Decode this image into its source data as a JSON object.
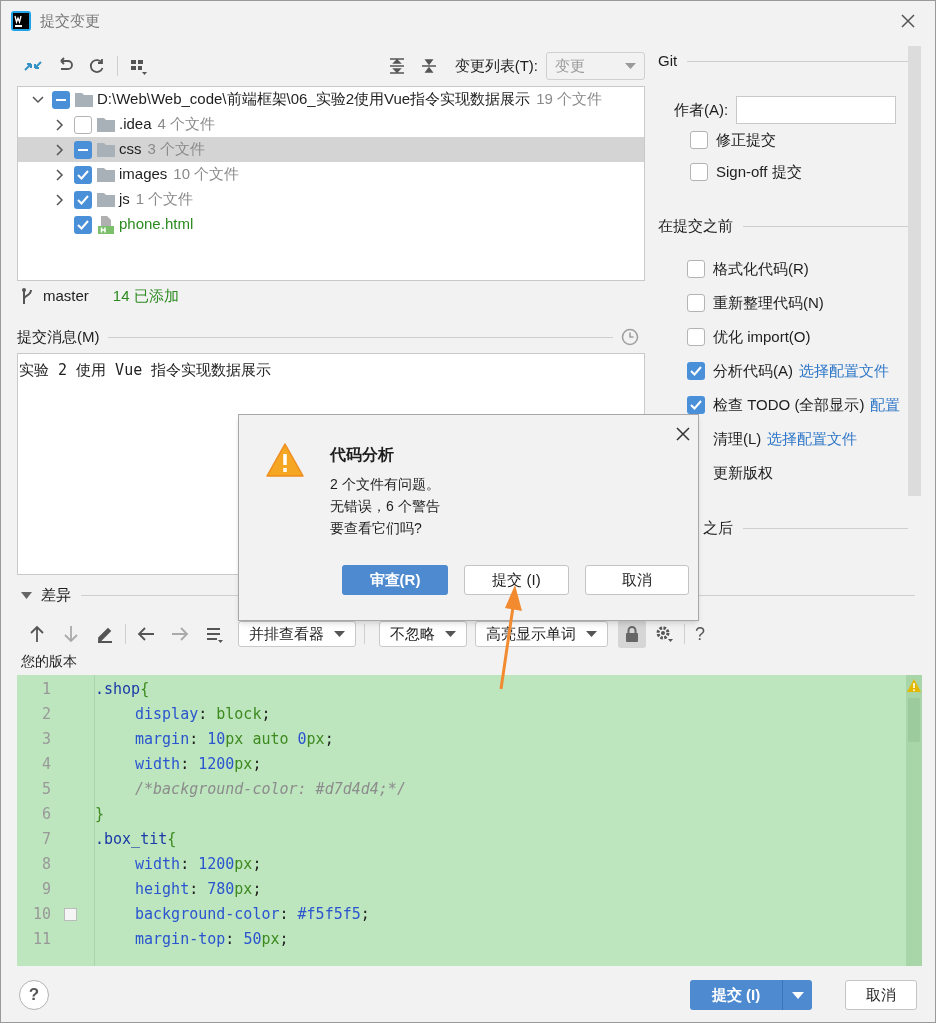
{
  "window": {
    "title": "提交变更"
  },
  "changes_toolbar": {
    "changelist_label": "变更列表(T):",
    "changelist_value": "变更"
  },
  "tree": [
    {
      "label": "D:\\Web\\Web_code\\前端框架\\06_实验2使用Vue指令实现数据展示",
      "count": "19 个文件",
      "kind": "folder",
      "partial": true,
      "expanded": true,
      "selected": false,
      "children": [
        {
          "label": ".idea",
          "count": "4 个文件",
          "kind": "folder",
          "checked": false,
          "expanded": false,
          "selected": false
        },
        {
          "label": "css",
          "count": "3 个文件",
          "kind": "folder",
          "partial": true,
          "expanded": false,
          "selected": true
        },
        {
          "label": "images",
          "count": "10 个文件",
          "kind": "folder",
          "checked": true,
          "expanded": false,
          "selected": false
        },
        {
          "label": "js",
          "count": "1 个文件",
          "kind": "folder",
          "checked": true,
          "expanded": false,
          "selected": false
        },
        {
          "label": "phone.html",
          "kind": "html",
          "checked": true,
          "added": true,
          "selected": false
        }
      ]
    }
  ],
  "branch": {
    "name": "master",
    "status": "14 已添加"
  },
  "commit_message": {
    "label": "提交消息(M)",
    "value": "实验 2 使用 Vue 指令实现数据展示"
  },
  "git": {
    "title": "Git",
    "author_label": "作者(A):",
    "options": [
      {
        "label": "修正提交",
        "checked": false
      },
      {
        "label": "Sign-off 提交",
        "checked": false
      }
    ]
  },
  "before_commit": {
    "title": "在提交之前",
    "options": [
      {
        "label": "格式化代码(R)",
        "checked": false
      },
      {
        "label": "重新整理代码(N)",
        "checked": false
      },
      {
        "label": "优化 import(O)",
        "checked": false
      },
      {
        "label": "分析代码(A)",
        "checked": true,
        "link": "选择配置文件"
      },
      {
        "label": "检查 TODO (全部显示)",
        "checked": true,
        "link": "配置"
      },
      {
        "label": "清理(L)",
        "link": "选择配置文件"
      },
      {
        "label": "更新版权"
      }
    ]
  },
  "after_commit": {
    "title": "之后"
  },
  "diff": {
    "label": "差异",
    "expanded": true,
    "dropdowns": [
      "并排查看器",
      "不忽略",
      "高亮显示单词"
    ],
    "lock_on": true,
    "help": "?",
    "version_label": "您的版本",
    "lines": [
      {
        "n": "1",
        "indent": false,
        "tokens": [
          {
            "kind": "sel",
            "t": ".shop"
          },
          {
            "kind": "brace",
            "t": "{"
          }
        ]
      },
      {
        "n": "2",
        "indent": true,
        "tokens": [
          {
            "kind": "prop",
            "t": "display"
          },
          {
            "kind": "punct",
            "t": ": "
          },
          {
            "kind": "val",
            "t": "block"
          },
          {
            "kind": "punct",
            "t": ";"
          }
        ]
      },
      {
        "n": "3",
        "indent": true,
        "tokens": [
          {
            "kind": "prop",
            "t": "margin"
          },
          {
            "kind": "punct",
            "t": ": "
          },
          {
            "kind": "num",
            "t": "10"
          },
          {
            "kind": "unit",
            "t": "px"
          },
          {
            "kind": "val",
            "t": " auto "
          },
          {
            "kind": "num",
            "t": "0"
          },
          {
            "kind": "unit",
            "t": "px"
          },
          {
            "kind": "punct",
            "t": ";"
          }
        ]
      },
      {
        "n": "4",
        "indent": true,
        "tokens": [
          {
            "kind": "prop",
            "t": "width"
          },
          {
            "kind": "punct",
            "t": ": "
          },
          {
            "kind": "num",
            "t": "1200"
          },
          {
            "kind": "unit",
            "t": "px"
          },
          {
            "kind": "punct",
            "t": ";"
          }
        ]
      },
      {
        "n": "5",
        "indent": true,
        "tokens": [
          {
            "kind": "comment",
            "t": "/*background-color: #d7d4d4;*/"
          }
        ]
      },
      {
        "n": "6",
        "indent": false,
        "tokens": [
          {
            "kind": "brace",
            "t": "}"
          }
        ]
      },
      {
        "n": "7",
        "indent": false,
        "tokens": [
          {
            "kind": "sel",
            "t": ".box_tit"
          },
          {
            "kind": "brace",
            "t": "{"
          }
        ]
      },
      {
        "n": "8",
        "indent": true,
        "tokens": [
          {
            "kind": "prop",
            "t": "width"
          },
          {
            "kind": "punct",
            "t": ": "
          },
          {
            "kind": "num",
            "t": "1200"
          },
          {
            "kind": "unit",
            "t": "px"
          },
          {
            "kind": "punct",
            "t": ";"
          }
        ]
      },
      {
        "n": "9",
        "indent": true,
        "tokens": [
          {
            "kind": "prop",
            "t": "height"
          },
          {
            "kind": "punct",
            "t": ": "
          },
          {
            "kind": "num",
            "t": "780"
          },
          {
            "kind": "unit",
            "t": "px"
          },
          {
            "kind": "punct",
            "t": ";"
          }
        ]
      },
      {
        "n": "10",
        "indent": true,
        "swatch": true,
        "tokens": [
          {
            "kind": "prop",
            "t": "background-color"
          },
          {
            "kind": "punct",
            "t": ": "
          },
          {
            "kind": "num",
            "t": "#f5f5f5"
          },
          {
            "kind": "punct",
            "t": ";"
          }
        ]
      },
      {
        "n": "11",
        "indent": true,
        "tokens": [
          {
            "kind": "prop",
            "t": "margin-top"
          },
          {
            "kind": "punct",
            "t": ": "
          },
          {
            "kind": "num",
            "t": "50"
          },
          {
            "kind": "unit",
            "t": "px"
          },
          {
            "kind": "punct",
            "t": ";"
          }
        ]
      }
    ]
  },
  "dialog": {
    "title": "代码分析",
    "lines": [
      "2 个文件有问题。",
      "无错误，6 个警告",
      "要查看它们吗?"
    ],
    "buttons": [
      {
        "label": "审查(R)",
        "default": true
      },
      {
        "label": "提交 (I)",
        "default": false
      },
      {
        "label": "取消",
        "default": false
      }
    ]
  },
  "footer": {
    "help": "?",
    "buttons": [
      {
        "label": "提交 (I)",
        "kind": "split",
        "default": true
      },
      {
        "label": "取消",
        "kind": "plain",
        "default": false
      }
    ]
  }
}
